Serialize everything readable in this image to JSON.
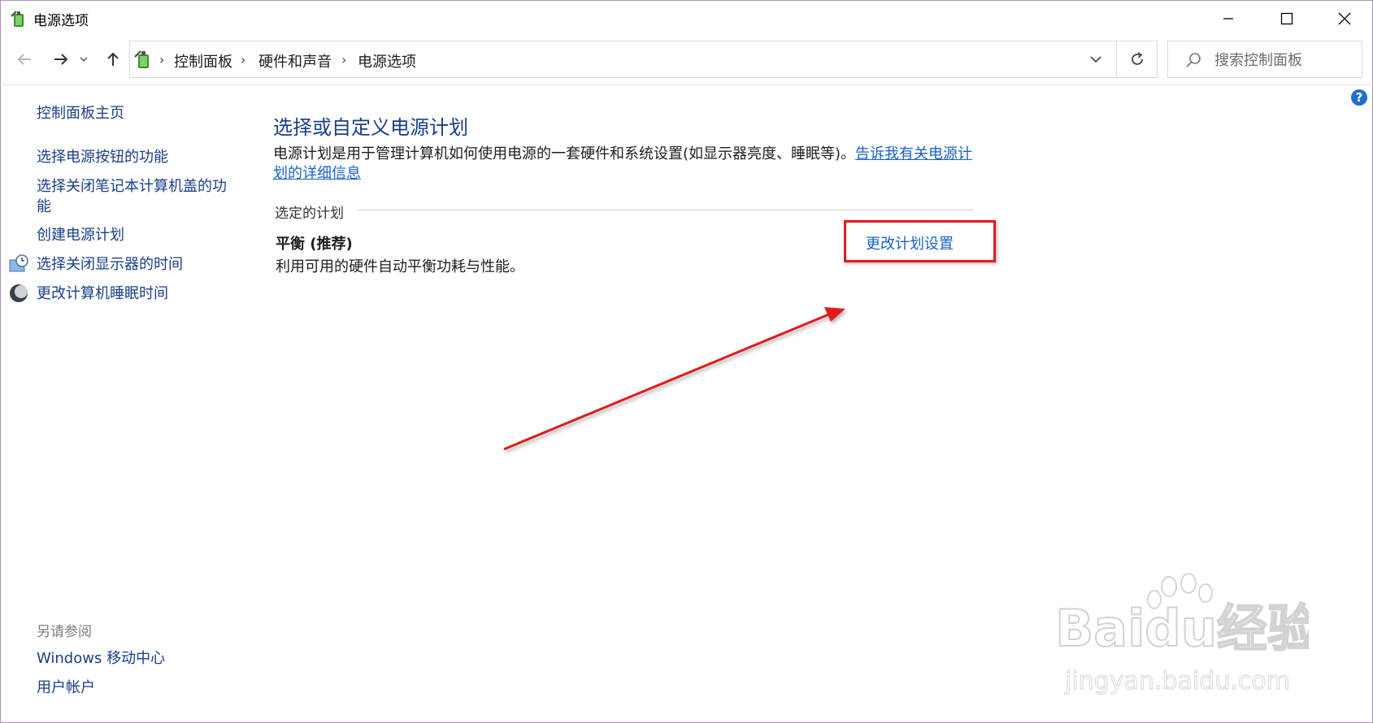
{
  "window": {
    "title": "电源选项"
  },
  "address": {
    "breadcrumbs": [
      "控制面板",
      "硬件和声音",
      "电源选项"
    ]
  },
  "search": {
    "placeholder": "搜索控制面板"
  },
  "sidebar": {
    "items": [
      {
        "label": "控制面板主页"
      },
      {
        "label": "选择电源按钮的功能"
      },
      {
        "label": "选择关闭笔记本计算机盖的功能"
      },
      {
        "label": "创建电源计划"
      },
      {
        "label": "选择关闭显示器的时间"
      },
      {
        "label": "更改计算机睡眠时间"
      }
    ],
    "see_also_title": "另请参阅",
    "see_also": [
      {
        "label": "Windows 移动中心"
      },
      {
        "label": "用户帐户"
      }
    ]
  },
  "main": {
    "heading": "选择或自定义电源计划",
    "description": "电源计划是用于管理计算机如何使用电源的一套硬件和系统设置(如显示器亮度、睡眠等)。",
    "description_link": "告诉我有关电源计划的详细信息",
    "group_label": "选定的计划",
    "plan": {
      "name": "平衡 (推荐)",
      "description": "利用可用的硬件自动平衡功耗与性能。",
      "change_link": "更改计划设置"
    }
  },
  "watermark": {
    "brand": "Baidu经验",
    "url": "jingyan.baidu.com"
  },
  "colors": {
    "link": "#1a62c8",
    "heading": "#1a3f8a",
    "annotation": "#e01c1c"
  }
}
